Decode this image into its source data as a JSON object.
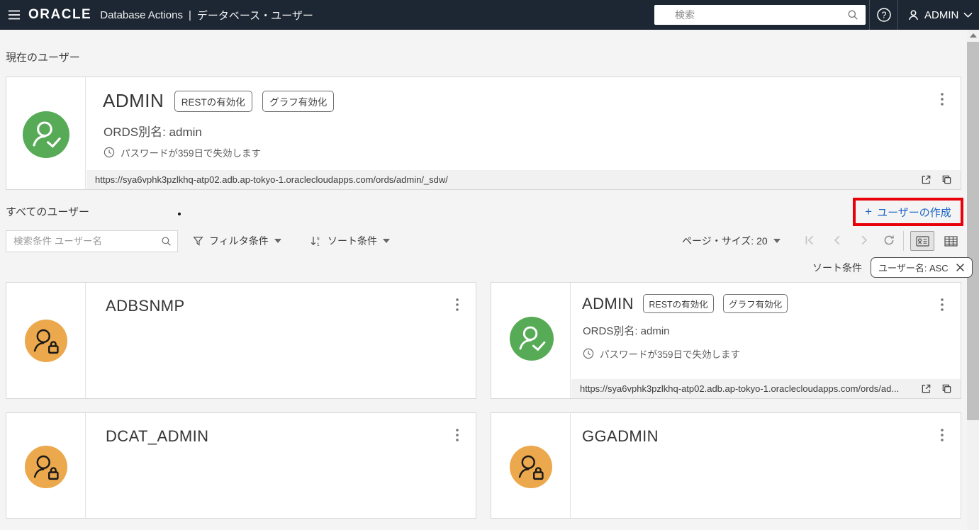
{
  "header": {
    "brand": "ORACLE",
    "app_title": "Database Actions",
    "separator": "|",
    "page_title": "データベース・ユーザー",
    "search_placeholder": "検索",
    "user_label": "ADMIN"
  },
  "sections": {
    "current": {
      "title": "現在のユーザー"
    },
    "all": {
      "title": "すべてのユーザー"
    }
  },
  "current_card": {
    "name": "ADMIN",
    "badges": [
      "RESTの有効化",
      "グラフ有効化"
    ],
    "ords_alias": "ORDS別名: admin",
    "password_note": "パスワードが359日で失効します",
    "url": "https://sya6vphk3pzlkhq-atp02.adb.ap-tokyo-1.oraclecloudapps.com/ords/admin/_sdw/"
  },
  "create_button": {
    "plus": "+",
    "label": "ユーザーの作成"
  },
  "toolbar": {
    "search_placeholder": "検索条件 ユーザー名",
    "filter_label": "フィルタ条件",
    "sort_label": "ソート条件",
    "page_size_label": "ページ・サイズ: 20"
  },
  "sort_chip": {
    "label": "ソート条件",
    "value": "ユーザー名: ASC"
  },
  "users": [
    {
      "name": "ADBSNMP",
      "status": "locked"
    },
    {
      "name": "ADMIN",
      "status": "open",
      "badges": [
        "RESTの有効化",
        "グラフ有効化"
      ],
      "ords_alias": "ORDS別名: admin",
      "password_note": "パスワードが359日で失効します",
      "url": "https://sya6vphk3pzlkhq-atp02.adb.ap-tokyo-1.oraclecloudapps.com/ords/ad..."
    },
    {
      "name": "DCAT_ADMIN",
      "status": "locked"
    },
    {
      "name": "GGADMIN",
      "status": "locked"
    }
  ],
  "colors": {
    "header_bg": "#1d2733",
    "accent_blue": "#1b64c4",
    "avatar_green": "#57ab57",
    "avatar_orange": "#eca84c",
    "annotation_red": "#e8000a",
    "url_bar_bg": "#f1f1f1"
  }
}
